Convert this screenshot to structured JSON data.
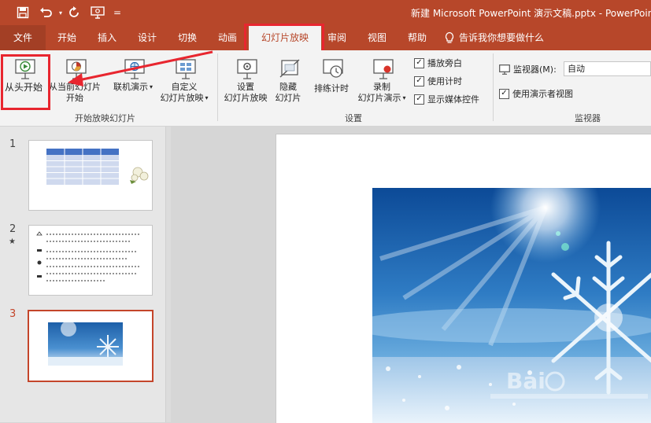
{
  "window": {
    "title": "新建 Microsoft PowerPoint 演示文稿.pptx  -  PowerPoint"
  },
  "qat": {
    "save_icon": "save-icon",
    "undo_icon": "undo-icon",
    "redo_icon": "redo-icon",
    "present_icon": "present-icon",
    "more_glyph": "="
  },
  "tabs": [
    {
      "label": "文件"
    },
    {
      "label": "开始"
    },
    {
      "label": "插入"
    },
    {
      "label": "设计"
    },
    {
      "label": "切换"
    },
    {
      "label": "动画"
    },
    {
      "label": "幻灯片放映"
    },
    {
      "label": "审阅"
    },
    {
      "label": "视图"
    },
    {
      "label": "帮助"
    }
  ],
  "tell_me": "告诉我你想要做什么",
  "ribbon": {
    "from_beginning": "从头开始",
    "from_current_l1": "从当前幻灯片",
    "from_current_l2": "开始",
    "online_present": "联机演示",
    "custom_l1": "自定义",
    "custom_l2": "幻灯片放映",
    "group_start": "开始放映幻灯片",
    "setup_l1": "设置",
    "setup_l2": "幻灯片放映",
    "hide_l1": "隐藏",
    "hide_l2": "幻灯片",
    "rehearse": "排练计时",
    "record_l1": "录制",
    "record_l2": "幻灯片演示",
    "chk_narration": "播放旁白",
    "chk_timings": "使用计时",
    "chk_media": "显示媒体控件",
    "group_setup": "设置",
    "monitor_label": "监视器(M):",
    "monitor_value": "自动",
    "presenter_view": "使用演示者视图",
    "group_monitor": "监视器",
    "caret": "▾",
    "check": "✓"
  },
  "slides": [
    {
      "number": "1"
    },
    {
      "number": "2",
      "mark": "★"
    },
    {
      "number": "3"
    }
  ],
  "accent": "#b7472a",
  "highlight": "#e8262f"
}
